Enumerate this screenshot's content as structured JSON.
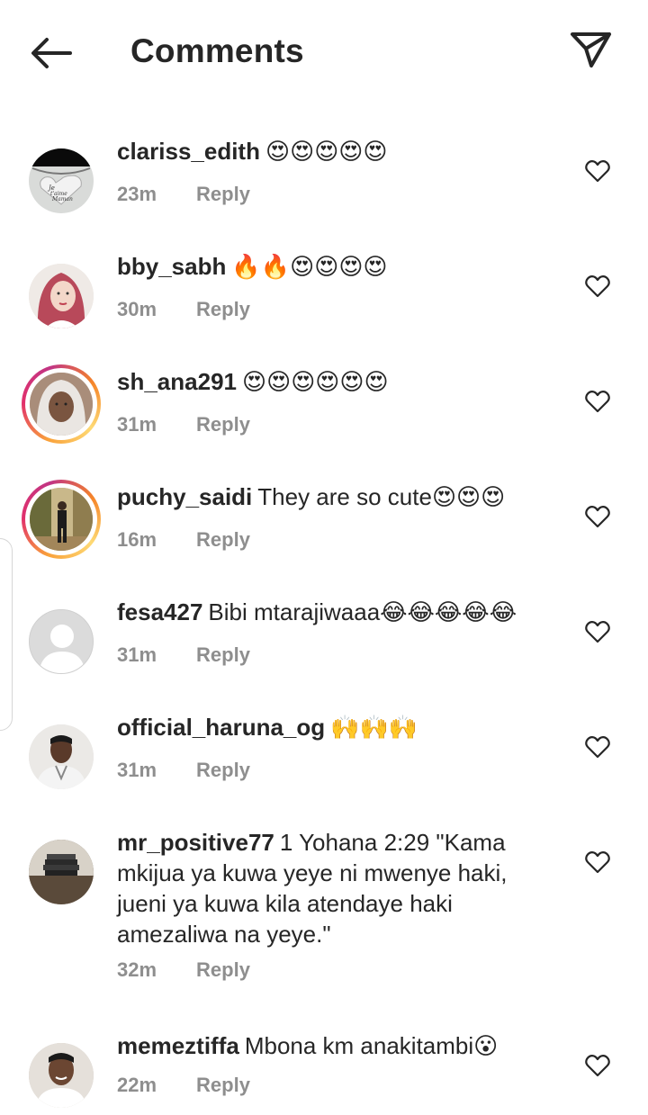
{
  "header": {
    "title": "Comments",
    "back_icon": "arrow-left-icon",
    "share_icon": "paper-plane-icon"
  },
  "colors": {
    "text": "#262626",
    "muted": "#8e8e8e",
    "story_ring_start": "#f58529",
    "story_ring_end": "#c13584"
  },
  "comments": [
    {
      "username": "clariss_edith",
      "text": "",
      "emoji": "😍😍😍😍😍",
      "time": "23m",
      "reply": "Reply",
      "avatar_icon": "heart-necklace-avatar",
      "story_ring": false
    },
    {
      "username": "bby_sabh",
      "text": "",
      "emoji": "🔥🔥😍😍😍😍",
      "time": "30m",
      "reply": "Reply",
      "avatar_icon": "illustrated-woman-avatar",
      "story_ring": false
    },
    {
      "username": "sh_ana291",
      "text": "",
      "emoji": "😍😍😍😍😍😍",
      "time": "31m",
      "reply": "Reply",
      "avatar_icon": "woman-hijab-avatar",
      "story_ring": true
    },
    {
      "username": "puchy_saidi",
      "text": "They are so cute",
      "emoji": "😍😍😍",
      "time": "16m",
      "reply": "Reply",
      "avatar_icon": "man-outdoors-avatar",
      "story_ring": true
    },
    {
      "username": "fesa427",
      "text": "Bibi mtarajiwaaa",
      "emoji": "😂😂😂😂😂",
      "time": "31m",
      "reply": "Reply",
      "avatar_icon": "default-user-avatar",
      "story_ring": false
    },
    {
      "username": "official_haruna_og",
      "text": "",
      "emoji": "🙌🙌🙌",
      "time": "31m",
      "reply": "Reply",
      "avatar_icon": "young-man-avatar",
      "story_ring": false
    },
    {
      "username": "mr_positive77",
      "text": "1 Yohana 2:29 \"Kama mkijua ya kuwa yeye ni mwenye haki, jueni ya kuwa kila atendaye haki amezaliwa na yeye.\"",
      "emoji": "",
      "time": "32m",
      "reply": "Reply",
      "avatar_icon": "books-avatar",
      "story_ring": false
    },
    {
      "username": "memeztiffa",
      "text": "Mbona km anakitambi",
      "emoji": "😮",
      "time": "22m",
      "reply": "Reply",
      "avatar_icon": "smiling-person-avatar",
      "story_ring": false
    }
  ]
}
